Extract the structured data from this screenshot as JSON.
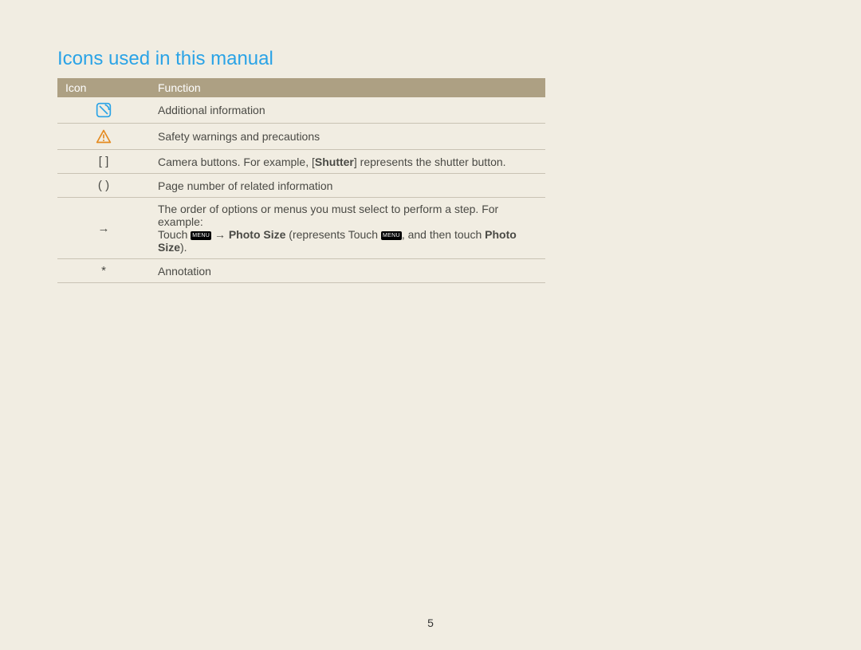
{
  "title": "Icons used in this manual",
  "table": {
    "headers": {
      "icon": "Icon",
      "function": "Function"
    },
    "rows": [
      {
        "icon_name": "note-icon",
        "icon_text": "",
        "function": "Additional information"
      },
      {
        "icon_name": "warning-icon",
        "icon_text": "",
        "function": "Safety warnings and precautions"
      },
      {
        "icon_name": "brackets-icon",
        "icon_text": "[  ]",
        "function_prefix": "Camera buttons. For example, [",
        "bold1": "Shutter",
        "function_suffix": "] represents the shutter button."
      },
      {
        "icon_name": "parens-icon",
        "icon_text": "(  )",
        "function": "Page number of related information"
      },
      {
        "icon_name": "arrow-icon",
        "icon_text": "→",
        "line1": "The order of options or menus you must select to perform a step. For example:",
        "touch": "Touch",
        "menu_label": "MENU",
        "arrow": "→",
        "photo_size": "Photo Size",
        "represents": " (represents Touch ",
        "and_then": ", and then touch ",
        "close": ")."
      },
      {
        "icon_name": "asterisk-icon",
        "icon_text": "*",
        "function": "Annotation"
      }
    ]
  },
  "page_number": "5"
}
